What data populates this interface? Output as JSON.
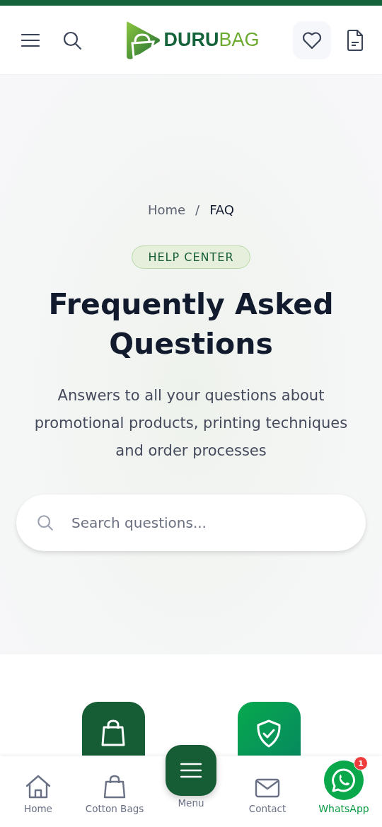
{
  "header": {
    "logo": {
      "strong": "DURU",
      "light": "BAG"
    }
  },
  "breadcrumb": [
    {
      "label": "Home",
      "current": false
    },
    {
      "label": "FAQ",
      "current": true
    }
  ],
  "breadcrumb_separator": "/",
  "badge": "HELP CENTER",
  "title": "Frequently Asked Questions",
  "subtitle": "Answers to all your questions about promotional products, printing techniques and order processes",
  "search": {
    "placeholder": "Search questions..."
  },
  "category_tiles": [
    {
      "kind": "bag"
    },
    {
      "kind": "shield"
    }
  ],
  "bottom_nav": [
    {
      "kind": "home",
      "label": "Home"
    },
    {
      "kind": "bag",
      "label": "Cotton Bags"
    },
    {
      "kind": "menu",
      "label": "Menu"
    },
    {
      "kind": "mail",
      "label": "Contact"
    },
    {
      "kind": "whatsapp",
      "label": "WhatsApp",
      "badge": "1"
    }
  ]
}
